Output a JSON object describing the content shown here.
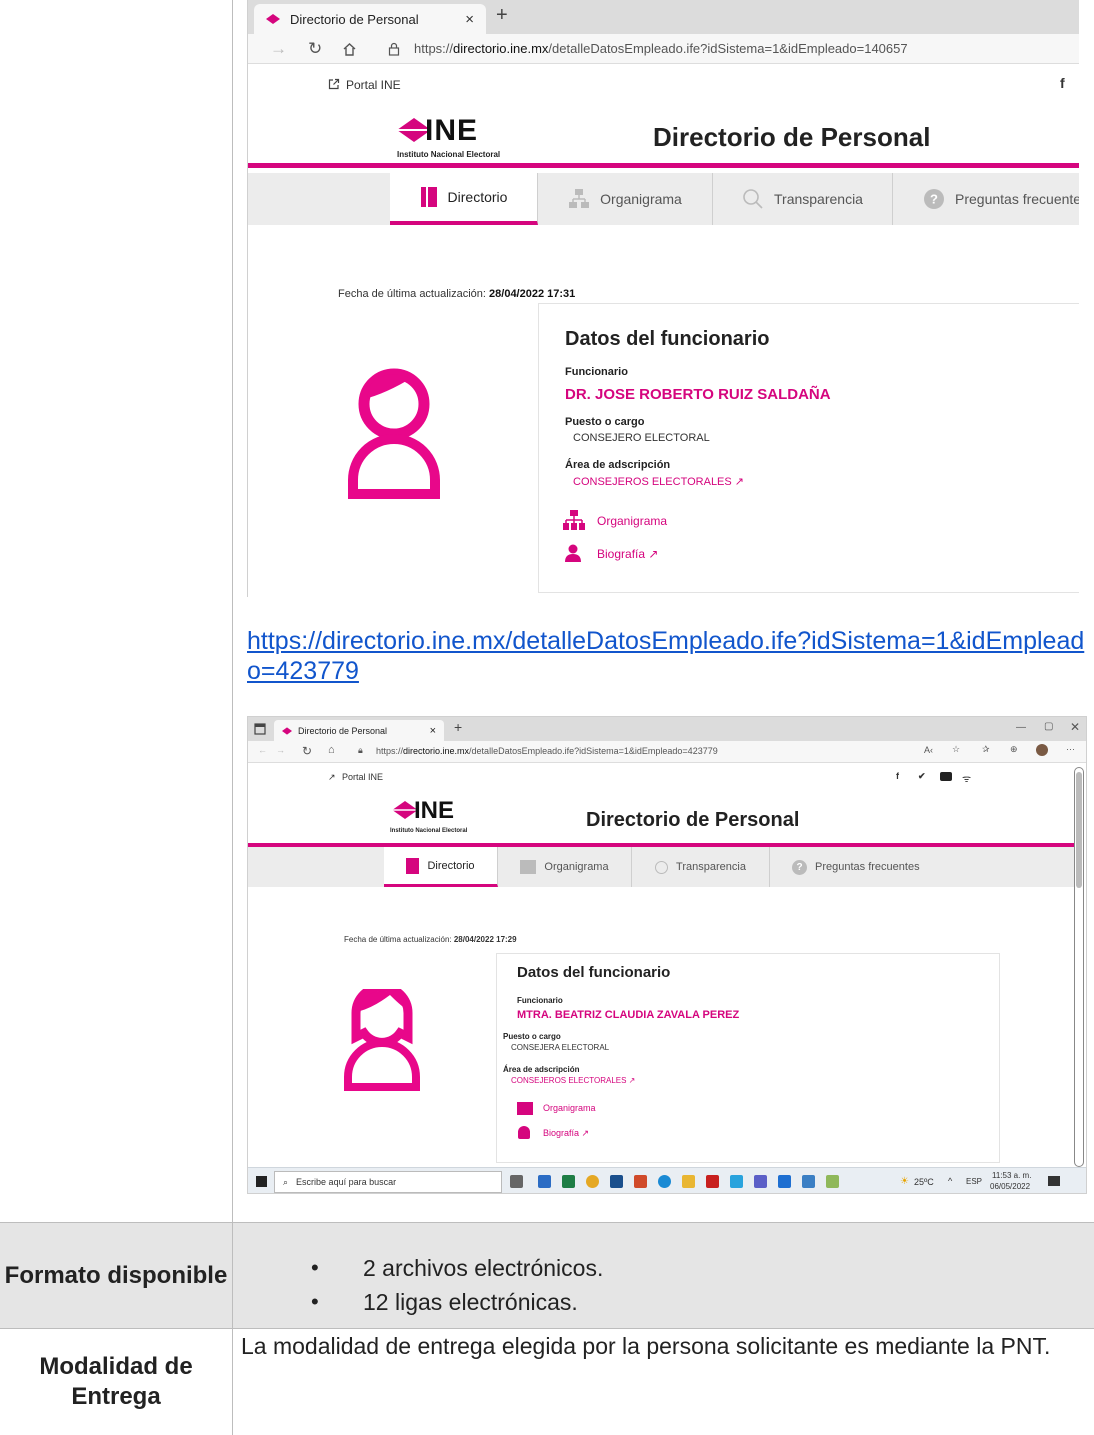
{
  "screenshot1": {
    "tab_title": "Directorio de Personal",
    "tab_close": "×",
    "new_tab": "+",
    "url_prefix": "https://",
    "url_domain": "directorio.ine.mx",
    "url_path": "/detalleDatosEmpleado.ife?idSistema=1&idEmpleado=140657",
    "portal_link": "Portal INE",
    "facebook": "f",
    "logo_word": "INE",
    "logo_subtitle": "Instituto Nacional Electoral",
    "page_title": "Directorio de Personal",
    "menu": [
      "Directorio",
      "Organigrama",
      "Transparencia",
      "Preguntas frecuentes"
    ],
    "fecha_label": "Fecha de última actualización:",
    "fecha_value": "28/04/2022 17:31",
    "card_title": "Datos del funcionario",
    "funcionario_label": "Funcionario",
    "funcionario_value": "DR. JOSE ROBERTO RUIZ SALDAÑA",
    "puesto_label": "Puesto o cargo",
    "puesto_value": "CONSEJERO ELECTORAL",
    "area_label": "Área de adscripción",
    "area_value": "CONSEJEROS ELECTORALES",
    "link_organigrama": "Organigrama",
    "link_biografia": "Biografía"
  },
  "link_text": "https://directorio.ine.mx/detalleDatosEmpleado.ife?idSistema=1&idEmpleado=423779",
  "screenshot2": {
    "tab_title": "Directorio de Personal",
    "tab_close": "×",
    "new_tab": "+",
    "url_prefix": "https://",
    "url_domain": "directorio.ine.mx",
    "url_path": "/detalleDatosEmpleado.ife?idSistema=1&idEmpleado=423779",
    "portal_link": "Portal INE",
    "logo_word": "INE",
    "logo_subtitle": "Instituto Nacional Electoral",
    "page_title": "Directorio de Personal",
    "menu": [
      "Directorio",
      "Organigrama",
      "Transparencia",
      "Preguntas frecuentes"
    ],
    "fecha_label": "Fecha de última actualización:",
    "fecha_value": "28/04/2022 17:29",
    "card_title": "Datos del funcionario",
    "funcionario_label": "Funcionario",
    "funcionario_value": "MTRA. BEATRIZ CLAUDIA ZAVALA PEREZ",
    "puesto_label": "Puesto o cargo",
    "puesto_value": "CONSEJERA ELECTORAL",
    "area_label": "Área de adscripción",
    "area_value": "CONSEJEROS ELECTORALES",
    "link_organigrama": "Organigrama",
    "link_biografia": "Biografía",
    "taskbar_search": "Escribe aquí para buscar",
    "weather": "25ºC",
    "lang": "ESP",
    "time": "11:53 a. m.",
    "date": "06/05/2022"
  },
  "formato": {
    "label": "Formato disponible",
    "items": [
      "2 archivos electrónicos.",
      "12 ligas electrónicas."
    ]
  },
  "modalidad": {
    "label": "Modalidad de Entrega",
    "text": "La modalidad de entrega elegida por la persona solicitante es mediante la PNT."
  },
  "colors": {
    "ine_pink": "#d5057e",
    "link_blue": "#1155cc"
  }
}
